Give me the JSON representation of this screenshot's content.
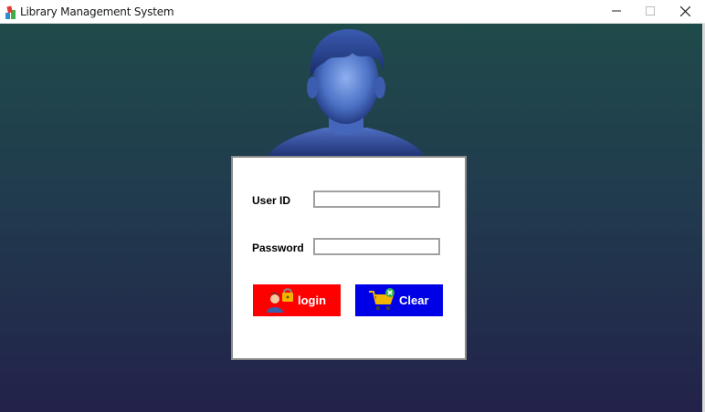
{
  "window": {
    "title": "Library Management System",
    "icon": "books-icon",
    "controls": [
      "minimize-icon",
      "maximize-icon",
      "close-icon"
    ]
  },
  "avatar": {
    "icon": "user-silhouette-icon"
  },
  "login": {
    "user_id_label": "User ID",
    "user_id_value": "",
    "password_label": "Password",
    "password_value": "",
    "login_button": {
      "label": "login",
      "icon": "user-lock-icon",
      "color": "#ff0000"
    },
    "clear_button": {
      "label": "Clear",
      "icon": "cart-remove-icon",
      "color": "#0000e6"
    }
  },
  "colors": {
    "background_top": "#1f4a4a",
    "background_bottom": "#22224a",
    "panel": "#ffffff"
  }
}
